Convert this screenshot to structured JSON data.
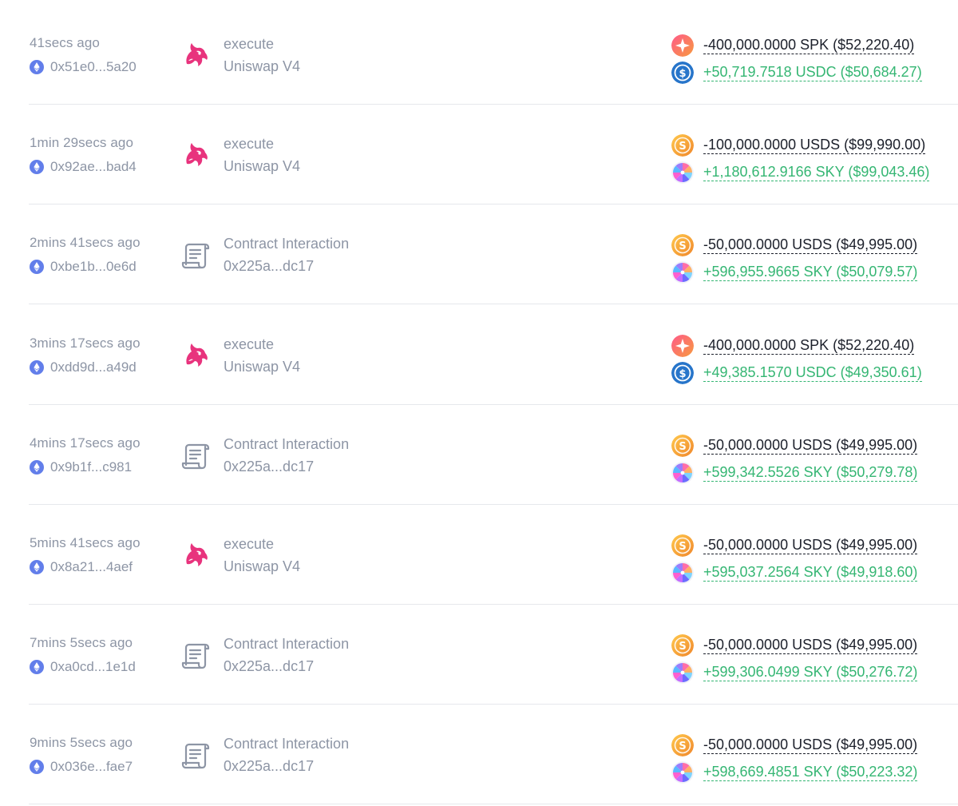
{
  "colors": {
    "text_muted": "#8d95a5",
    "text_dark": "#1b1f2a",
    "positive_green": "#35b673",
    "uniswap_pink": "#e8337d",
    "eth_blue": "#627eea",
    "usdc_blue": "#2775ca",
    "usds_orange": "#f4a637"
  },
  "transactions": [
    {
      "time": "41secs ago",
      "hash": "0x51e0...5a20",
      "method_icon": "uniswap-unicorn-icon",
      "method": "execute",
      "target": "Uniswap V4",
      "out": {
        "token_icon": "spk-token-icon",
        "amount": "-400,000.0000 SPK ($52,220.40)"
      },
      "in": {
        "token_icon": "usdc-token-icon",
        "amount": "+50,719.7518 USDC ($50,684.27)"
      }
    },
    {
      "time": "1min 29secs ago",
      "hash": "0x92ae...bad4",
      "method_icon": "uniswap-unicorn-icon",
      "method": "execute",
      "target": "Uniswap V4",
      "out": {
        "token_icon": "usds-token-icon",
        "amount": "-100,000.0000 USDS ($99,990.00)"
      },
      "in": {
        "token_icon": "sky-token-icon",
        "amount": "+1,180,612.9166 SKY ($99,043.46)"
      }
    },
    {
      "time": "2mins 41secs ago",
      "hash": "0xbe1b...0e6d",
      "method_icon": "contract-scroll-icon",
      "method": "Contract Interaction",
      "target": "0x225a...dc17",
      "out": {
        "token_icon": "usds-token-icon",
        "amount": "-50,000.0000 USDS ($49,995.00)"
      },
      "in": {
        "token_icon": "sky-token-icon",
        "amount": "+596,955.9665 SKY ($50,079.57)"
      }
    },
    {
      "time": "3mins 17secs ago",
      "hash": "0xdd9d...a49d",
      "method_icon": "uniswap-unicorn-icon",
      "method": "execute",
      "target": "Uniswap V4",
      "out": {
        "token_icon": "spk-token-icon",
        "amount": "-400,000.0000 SPK ($52,220.40)"
      },
      "in": {
        "token_icon": "usdc-token-icon",
        "amount": "+49,385.1570 USDC ($49,350.61)"
      }
    },
    {
      "time": "4mins 17secs ago",
      "hash": "0x9b1f...c981",
      "method_icon": "contract-scroll-icon",
      "method": "Contract Interaction",
      "target": "0x225a...dc17",
      "out": {
        "token_icon": "usds-token-icon",
        "amount": "-50,000.0000 USDS ($49,995.00)"
      },
      "in": {
        "token_icon": "sky-token-icon",
        "amount": "+599,342.5526 SKY ($50,279.78)"
      }
    },
    {
      "time": "5mins 41secs ago",
      "hash": "0x8a21...4aef",
      "method_icon": "uniswap-unicorn-icon",
      "method": "execute",
      "target": "Uniswap V4",
      "out": {
        "token_icon": "usds-token-icon",
        "amount": "-50,000.0000 USDS ($49,995.00)"
      },
      "in": {
        "token_icon": "sky-token-icon",
        "amount": "+595,037.2564 SKY ($49,918.60)"
      }
    },
    {
      "time": "7mins 5secs ago",
      "hash": "0xa0cd...1e1d",
      "method_icon": "contract-scroll-icon",
      "method": "Contract Interaction",
      "target": "0x225a...dc17",
      "out": {
        "token_icon": "usds-token-icon",
        "amount": "-50,000.0000 USDS ($49,995.00)"
      },
      "in": {
        "token_icon": "sky-token-icon",
        "amount": "+599,306.0499 SKY ($50,276.72)"
      }
    },
    {
      "time": "9mins 5secs ago",
      "hash": "0x036e...fae7",
      "method_icon": "contract-scroll-icon",
      "method": "Contract Interaction",
      "target": "0x225a...dc17",
      "out": {
        "token_icon": "usds-token-icon",
        "amount": "-50,000.0000 USDS ($49,995.00)"
      },
      "in": {
        "token_icon": "sky-token-icon",
        "amount": "+598,669.4851 SKY ($50,223.32)"
      }
    }
  ]
}
